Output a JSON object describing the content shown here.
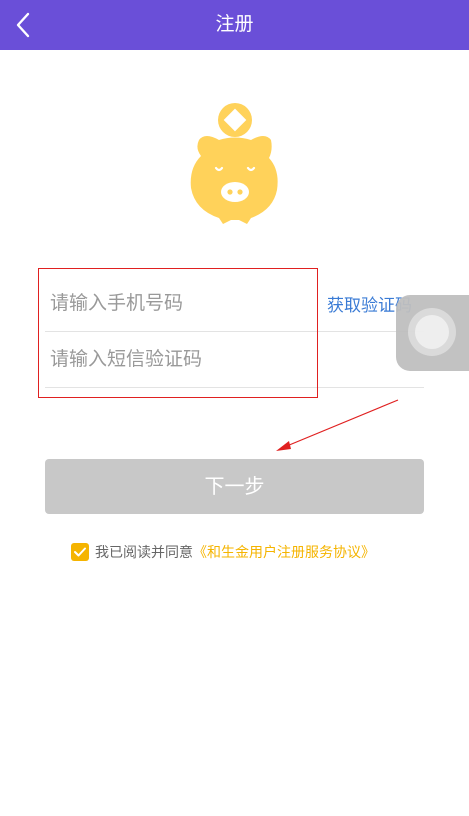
{
  "header": {
    "title": "注册",
    "back_icon": "chevron-left-icon",
    "background": "#6a4fd8"
  },
  "logo": {
    "icon": "piggy-bank-coin-icon",
    "color": "#ffd25a"
  },
  "form": {
    "phone_placeholder": "请输入手机号码",
    "code_placeholder": "请输入短信验证码",
    "get_code_label": "获取验证码"
  },
  "next_button": {
    "label": "下一步",
    "enabled": false
  },
  "agreement": {
    "checked": true,
    "text": "我已阅读并同意",
    "link_text": "《和生金用户注册服务协议》"
  },
  "colors": {
    "accent": "#6a4fd8",
    "link": "#3a7bd5",
    "checkbox": "#f5b400",
    "disabled_button": "#c8c8c8",
    "annotation": "#e02020"
  }
}
